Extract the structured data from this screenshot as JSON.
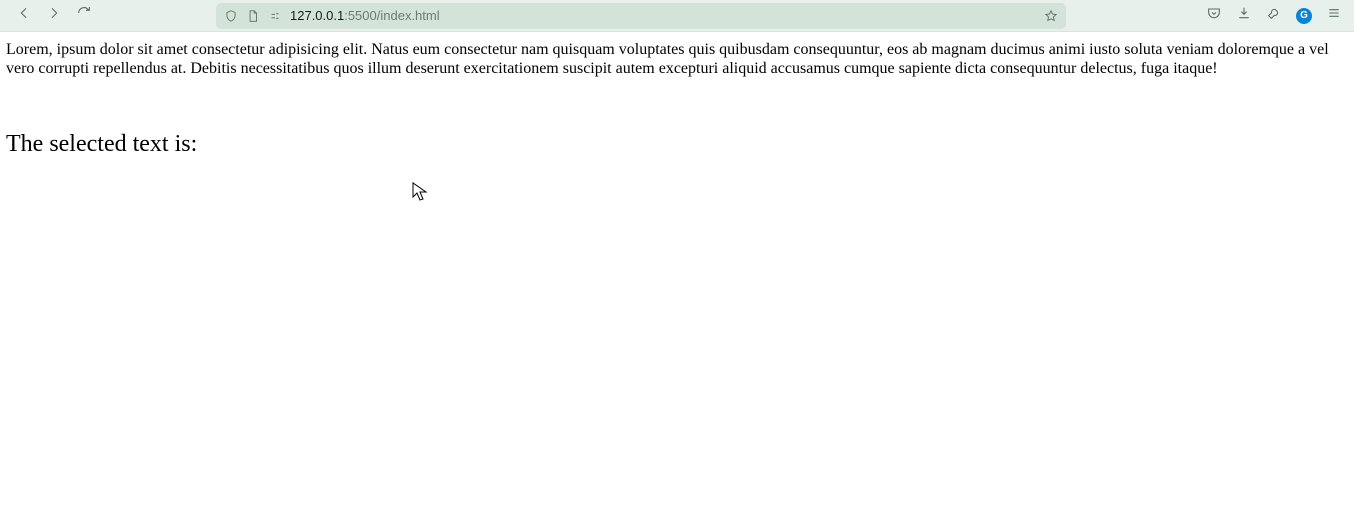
{
  "toolbar": {
    "url_host": "127.0.0.1",
    "url_port_path": ":5500/index.html",
    "icons": {
      "back": "back-icon",
      "forward": "forward-icon",
      "reload": "reload-icon",
      "shield": "shield-icon",
      "page": "page-icon",
      "permissions": "permissions-icon",
      "star": "bookmark-star-icon",
      "pocket": "pocket-icon",
      "download": "download-icon",
      "wrench": "wrench-icon",
      "extension_letter": "G",
      "menu": "menu-icon"
    }
  },
  "page": {
    "lorem": "Lorem, ipsum dolor sit amet consectetur adipisicing elit. Natus eum consectetur nam quisquam voluptates quis quibusdam consequuntur, eos ab magnam ducimus animi iusto soluta veniam doloremque a vel vero corrupti repellendus at. Debitis necessitatibus quos illum deserunt exercitationem suscipit autem excepturi aliquid accusamus cumque sapiente dicta consequuntur delectus, fuga itaque!",
    "heading": "The selected text is:"
  }
}
